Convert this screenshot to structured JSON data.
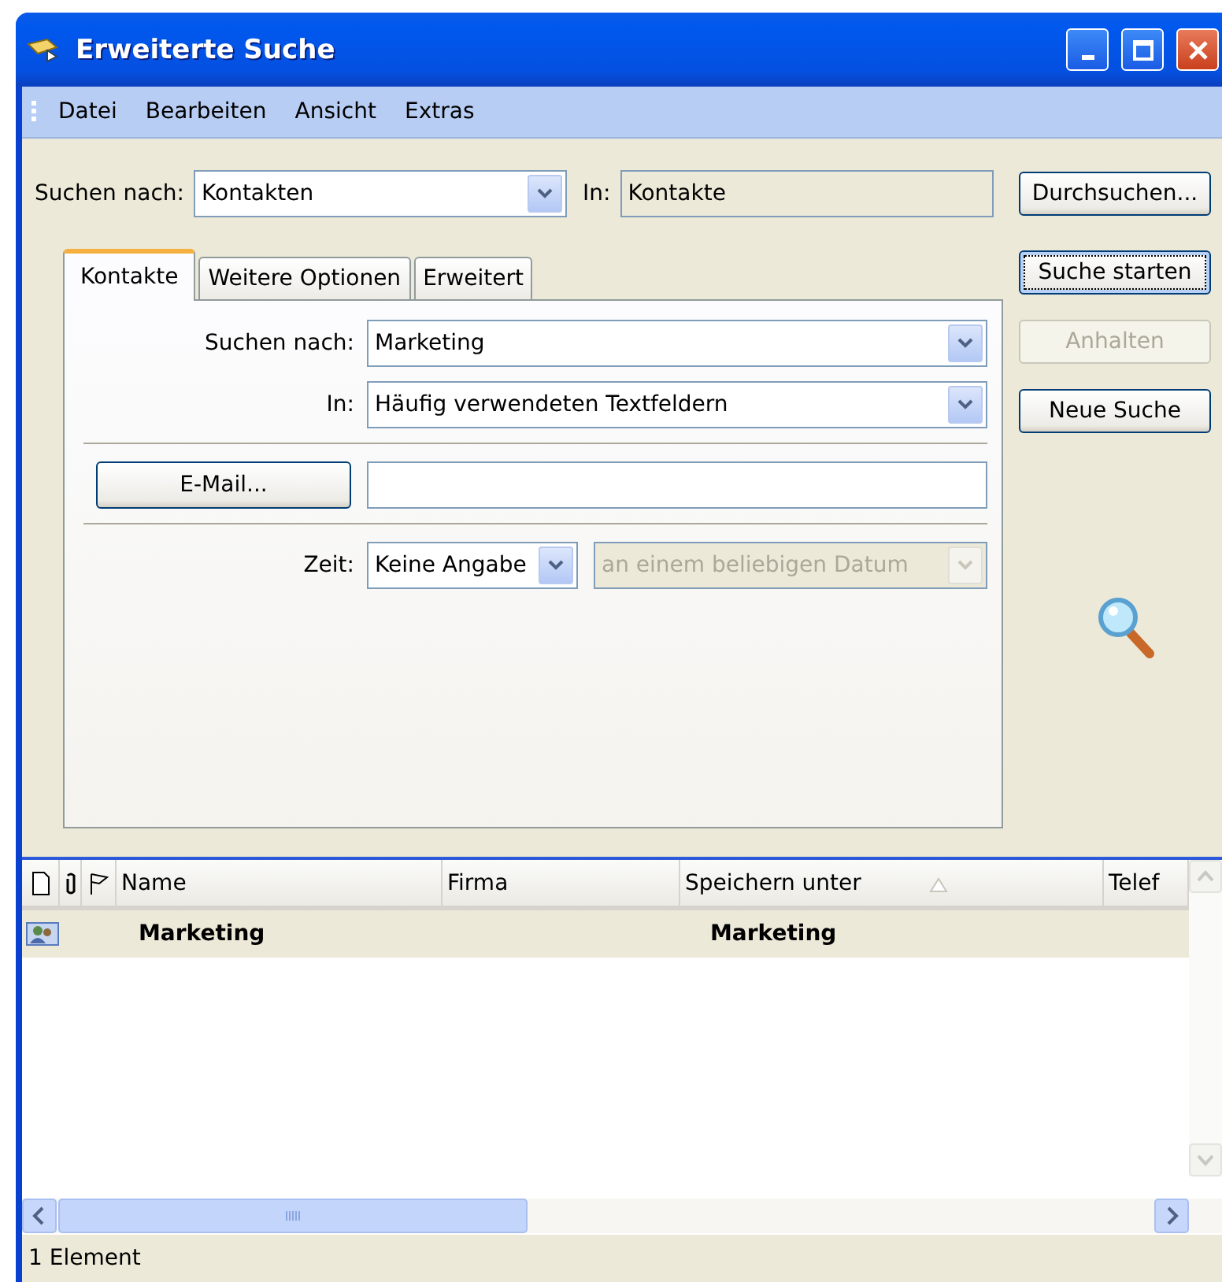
{
  "window": {
    "title": "Erweiterte Suche"
  },
  "menu": [
    "Datei",
    "Bearbeiten",
    "Ansicht",
    "Extras"
  ],
  "search_bar": {
    "label": "Suchen nach:",
    "look_for": "Kontakten",
    "in_label": "In:",
    "in_value": "Kontakte",
    "browse_button": "Durchsuchen..."
  },
  "tabs": [
    {
      "label": "Kontakte",
      "selected": true
    },
    {
      "label": "Weitere Optionen",
      "selected": false
    },
    {
      "label": "Erweitert",
      "selected": false
    }
  ],
  "form": {
    "search_for": {
      "label": "Suchen nach:",
      "value": "Marketing"
    },
    "in": {
      "label": "In:",
      "value": "Häufig verwendeten Textfeldern"
    },
    "email_button": "E-Mail...",
    "time": {
      "label": "Zeit:",
      "value": "Keine Angabe"
    },
    "date": {
      "value": "an einem beliebigen Datum",
      "disabled": true
    }
  },
  "actions": [
    {
      "label": "Suche starten",
      "disabled": false,
      "focused": true
    },
    {
      "label": "Anhalten",
      "disabled": true,
      "focused": false
    },
    {
      "label": "Neue Suche",
      "disabled": false,
      "focused": false
    }
  ],
  "results": {
    "columns": [
      {
        "label": "Name",
        "sorted": false
      },
      {
        "label": "Firma",
        "sorted": false
      },
      {
        "label": "Speichern unter",
        "sorted": true
      },
      {
        "label": "Telef",
        "sorted": false
      }
    ],
    "rows": [
      {
        "name": "Marketing",
        "save_as": "Marketing",
        "selected": true
      }
    ]
  },
  "status_bar": {
    "text": "1 Element"
  }
}
